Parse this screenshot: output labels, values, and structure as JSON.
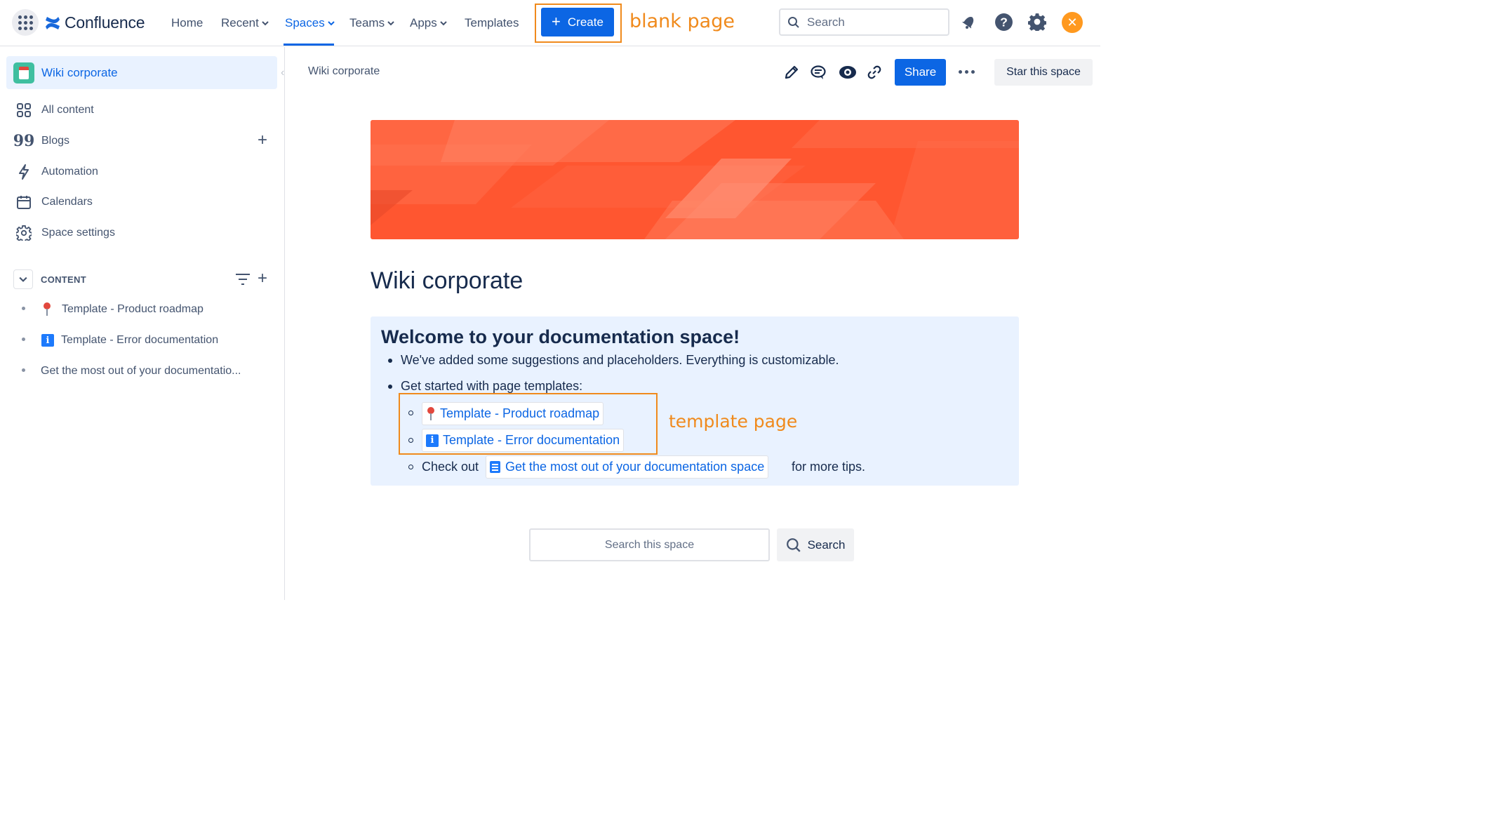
{
  "topnav": {
    "product_name": "Confluence",
    "items": [
      {
        "label": "Home",
        "has_dropdown": false
      },
      {
        "label": "Recent",
        "has_dropdown": true
      },
      {
        "label": "Spaces",
        "has_dropdown": true,
        "active": true
      },
      {
        "label": "Teams",
        "has_dropdown": true
      },
      {
        "label": "Apps",
        "has_dropdown": true
      },
      {
        "label": "Templates",
        "has_dropdown": false
      }
    ],
    "create_label": "Create",
    "search_placeholder": "Search",
    "icons": [
      "app-switcher-icon",
      "notifications-icon",
      "help-icon",
      "settings-icon",
      "profile-avatar"
    ]
  },
  "annotations": {
    "create_note": "blank page",
    "template_note": "template page",
    "color": "#f08a1c"
  },
  "sidebar": {
    "space_name": "Wiki corporate",
    "items": [
      {
        "label": "All content",
        "icon": "grid-icon"
      },
      {
        "label": "Blogs",
        "icon": "quote-icon"
      },
      {
        "label": "Automation",
        "icon": "lightning-icon"
      },
      {
        "label": "Calendars",
        "icon": "calendar-icon"
      },
      {
        "label": "Space settings",
        "icon": "gear-icon"
      }
    ],
    "content_header": "CONTENT",
    "tree": [
      {
        "label": "Template - Product roadmap",
        "icon": "pushpin-icon"
      },
      {
        "label": "Template - Error documentation",
        "icon": "info-icon"
      },
      {
        "label": "Get the most out of your documentatio...",
        "icon": ""
      }
    ]
  },
  "main": {
    "breadcrumb": "Wiki corporate",
    "share_label": "Share",
    "star_label": "Star this space",
    "page_title": "Wiki corporate",
    "panel": {
      "heading": "Welcome to your documentation space!",
      "bullet1": "We've added some suggestions and placeholders. Everything is customizable.",
      "bullet2": "Get started with page templates:",
      "link1": "Template - Product roadmap",
      "link2": "Template - Error documentation",
      "check_prefix": "Check out",
      "link3": "Get the most out of your documentation space",
      "check_suffix": "for more tips."
    },
    "space_search_placeholder": "Search this space",
    "space_search_button": "Search"
  },
  "colors": {
    "brand_blue": "#0c66e4",
    "banner_orange": "#ff5630",
    "panel_bg": "#e9f2ff"
  }
}
